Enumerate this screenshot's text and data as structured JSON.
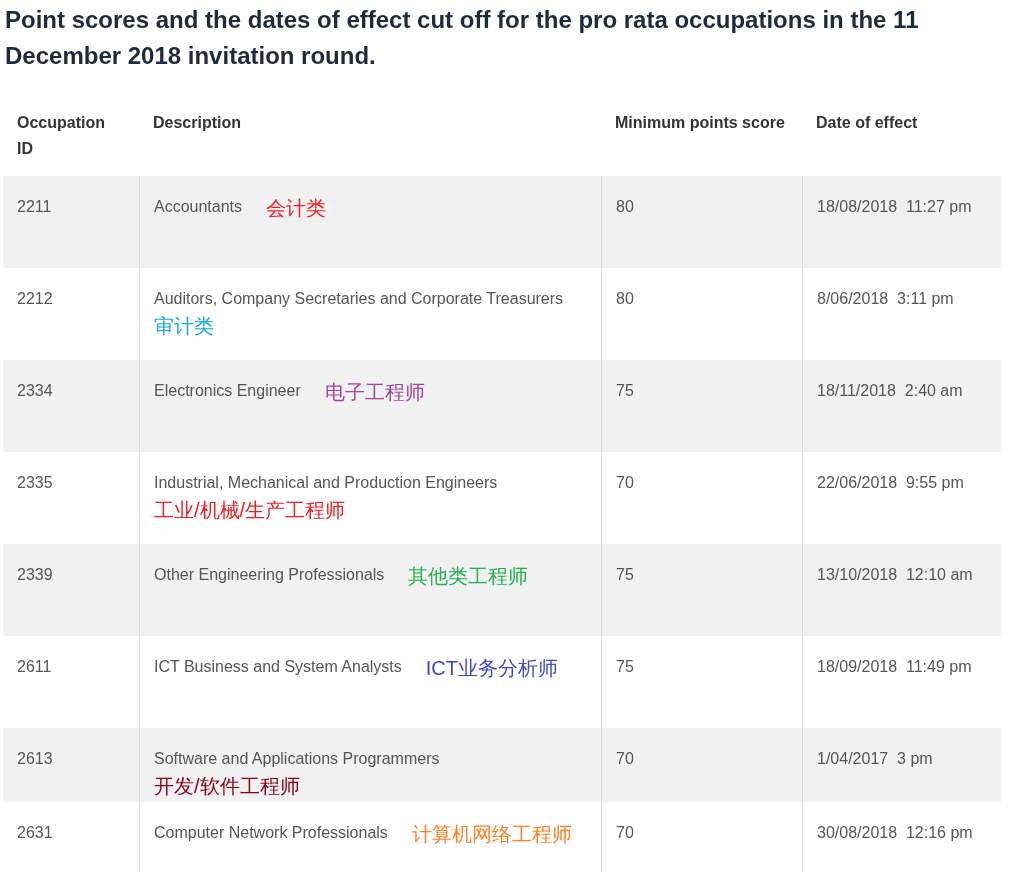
{
  "title": "Point scores and the dates of effect cut off for the pro rata occupations in the 11 December 2018 invitation round.",
  "table": {
    "columns": [
      "Occupation ID",
      "Description",
      "Minimum points score",
      "Date of effect"
    ],
    "rows": [
      {
        "id": "2211",
        "description": "Accountants",
        "note": "会计类",
        "color": "#ee1c25",
        "score": "80",
        "date": "18/08/2018  11:27 pm"
      },
      {
        "id": "2212",
        "description": "Auditors, Company Secretaries and Corporate Treasurers",
        "note": "审计类",
        "color": "#1aa3e8",
        "score": "80",
        "date": "8/06/2018  3:11 pm"
      },
      {
        "id": "2334",
        "description": "Electronics Engineer",
        "note": "电子工程师",
        "color": "#a3449c",
        "score": "75",
        "date": "18/11/2018  2:40 am"
      },
      {
        "id": "2335",
        "description": "Industrial, Mechanical and Production Engineers",
        "note": "工业/机械/生产工程师",
        "color": "#ee1c25",
        "score": "70",
        "date": "22/06/2018  9:55 pm"
      },
      {
        "id": "2339",
        "description": "Other Engineering Professionals",
        "note": "其他类工程师",
        "color": "#22b14c",
        "score": "75",
        "date": "13/10/2018  12:10 am"
      },
      {
        "id": "2611",
        "description": "ICT Business and System Analysts",
        "note": "ICT业务分析师",
        "color": "#3f48cc",
        "score": "75",
        "date": "18/09/2018  11:49 pm"
      },
      {
        "id": "2613",
        "description": "Software and Applications Programmers",
        "note": "开发/软件工程师",
        "color": "#880015",
        "score": "70",
        "date": "1/04/2017  3 pm"
      },
      {
        "id": "2631",
        "description": "Computer Network Professionals",
        "note": "计算机网络工程师",
        "color": "#ff7f27",
        "score": "70",
        "date": "30/08/2018  12:16 pm"
      }
    ]
  }
}
